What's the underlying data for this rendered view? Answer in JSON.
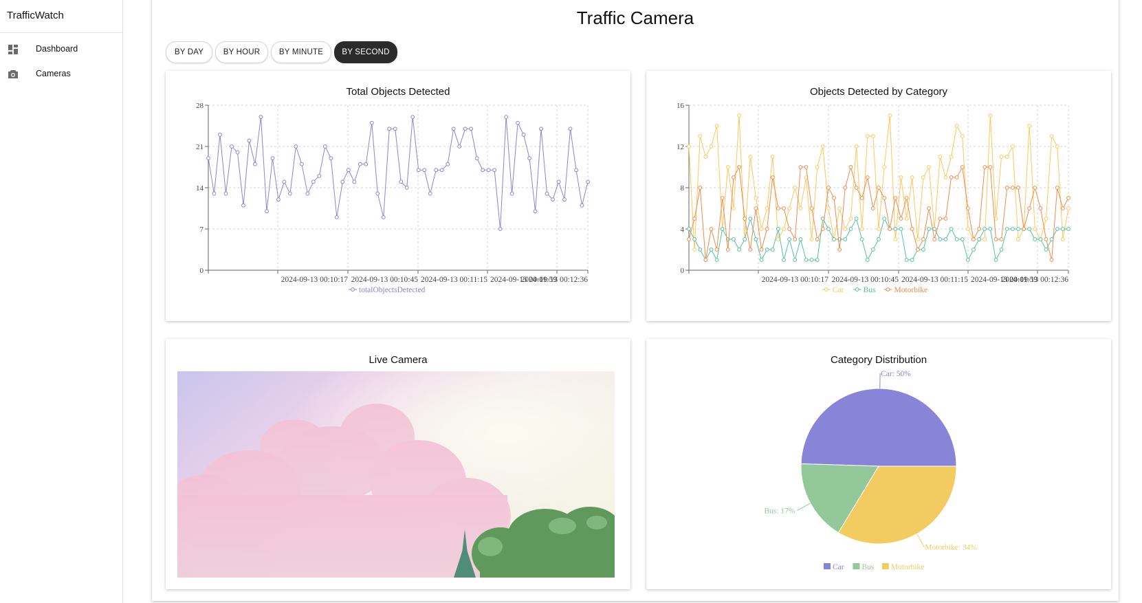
{
  "app": {
    "name": "TrafficWatch"
  },
  "sidebar": {
    "items": [
      {
        "label": "Dashboard",
        "icon": "dashboard-icon"
      },
      {
        "label": "Cameras",
        "icon": "camera-icon"
      }
    ]
  },
  "page": {
    "title": "Traffic Camera"
  },
  "granularity": {
    "options": [
      "BY DAY",
      "BY HOUR",
      "BY MINUTE",
      "BY SECOND"
    ],
    "selected": "BY SECOND"
  },
  "colors": {
    "total": "#8884d8",
    "car": "#ffc658",
    "bus": "#4fc3a1",
    "motorbike": "#f08a47",
    "pie_car": "#8884d8",
    "pie_bus": "#93c99a",
    "pie_motorbike": "#f2cc60"
  },
  "cards": {
    "total": {
      "title": "Total Objects Detected"
    },
    "category": {
      "title": "Objects Detected by Category"
    },
    "live": {
      "title": "Live Camera"
    },
    "distribution": {
      "title": "Category Distribution"
    }
  },
  "chart_data": [
    {
      "type": "line",
      "title": "Total Objects Detected",
      "x_tick_labels": [
        "2024-09-13 00:10:17",
        "2024-09-13 00:10:45",
        "2024-09-13 00:11:15",
        "2024-09-13 00:11:59",
        "2024-09-13 00:12:36"
      ],
      "y_ticks": [
        0,
        7,
        14,
        21,
        28
      ],
      "ylim": [
        0,
        28
      ],
      "grid": true,
      "legend": "bottom",
      "series": [
        {
          "name": "totalObjectsDetected",
          "values": [
            19,
            13,
            23,
            13,
            21,
            20,
            11,
            22,
            18,
            26,
            10,
            19,
            12,
            15,
            13,
            21,
            18,
            13,
            15,
            16,
            21,
            19,
            9,
            15,
            17,
            15,
            18,
            18,
            25,
            13,
            9,
            24,
            24,
            15,
            14,
            26,
            17,
            17,
            13,
            17,
            17,
            18,
            24,
            21,
            24,
            24,
            19,
            17,
            17,
            17,
            7,
            26,
            13,
            25,
            23,
            19,
            10,
            24,
            13,
            12,
            15,
            12,
            24,
            17,
            11,
            15
          ]
        }
      ]
    },
    {
      "type": "line",
      "title": "Objects Detected by Category",
      "x_tick_labels": [
        "2024-09-13 00:10:17",
        "2024-09-13 00:10:45",
        "2024-09-13 00:11:15",
        "2024-09-13 00:11:59",
        "2024-09-13 00:12:36"
      ],
      "y_ticks": [
        0,
        4,
        8,
        12,
        16
      ],
      "ylim": [
        0,
        16
      ],
      "grid": true,
      "legend": "bottom",
      "series": [
        {
          "name": "Car",
          "values": [
            12,
            2,
            13,
            11,
            12,
            14,
            4,
            10,
            6,
            15,
            3,
            11,
            7,
            4,
            6,
            11,
            3,
            4,
            6,
            8,
            6,
            9,
            3,
            10,
            12,
            6,
            3,
            6,
            4,
            5,
            12,
            4,
            13,
            13,
            4,
            10,
            15,
            3,
            9,
            5,
            9,
            3,
            9,
            10,
            4,
            11,
            9,
            11,
            14,
            13,
            4,
            3,
            3,
            3,
            15,
            5,
            11,
            11,
            12,
            3,
            4,
            14,
            4,
            3,
            5,
            13,
            12,
            3,
            6
          ]
        },
        {
          "name": "Bus",
          "values": [
            4,
            3,
            2,
            1,
            2,
            1,
            4,
            3,
            3,
            2,
            3,
            5,
            3,
            1,
            2,
            2,
            4,
            1,
            3,
            1,
            3,
            1,
            1,
            1,
            5,
            4,
            3,
            3,
            3,
            4,
            5,
            3,
            1,
            2,
            3,
            5,
            4,
            4,
            4,
            1,
            1,
            2,
            2,
            4,
            4,
            3,
            3,
            4,
            3,
            3,
            1,
            2,
            3,
            4,
            4,
            1,
            2,
            4,
            4,
            4,
            4,
            4,
            3,
            3,
            2,
            3,
            4,
            4,
            4
          ]
        },
        {
          "name": "Motorbike",
          "values": [
            3,
            5,
            8,
            1,
            4,
            2,
            7,
            2,
            9,
            10,
            5,
            2,
            6,
            2,
            4,
            9,
            6,
            6,
            4,
            3,
            10,
            10,
            6,
            3,
            4,
            8,
            7,
            2,
            8,
            10,
            8,
            7,
            9,
            6,
            8,
            7,
            4,
            7,
            5,
            7,
            4,
            2,
            3,
            6,
            3,
            5,
            5,
            9,
            9,
            10,
            6,
            3,
            4,
            10,
            10,
            3,
            3,
            8,
            8,
            8,
            4,
            6,
            8,
            6,
            3,
            1,
            8,
            6,
            7
          ]
        }
      ]
    },
    {
      "type": "pie",
      "title": "Category Distribution",
      "legend": "bottom",
      "labels": [
        "Car",
        "Bus",
        "Motorbike"
      ],
      "values": [
        50,
        17,
        34
      ],
      "value_labels": [
        "Car: 50%",
        "Bus: 17%",
        "Motorbike: 34%"
      ]
    }
  ]
}
